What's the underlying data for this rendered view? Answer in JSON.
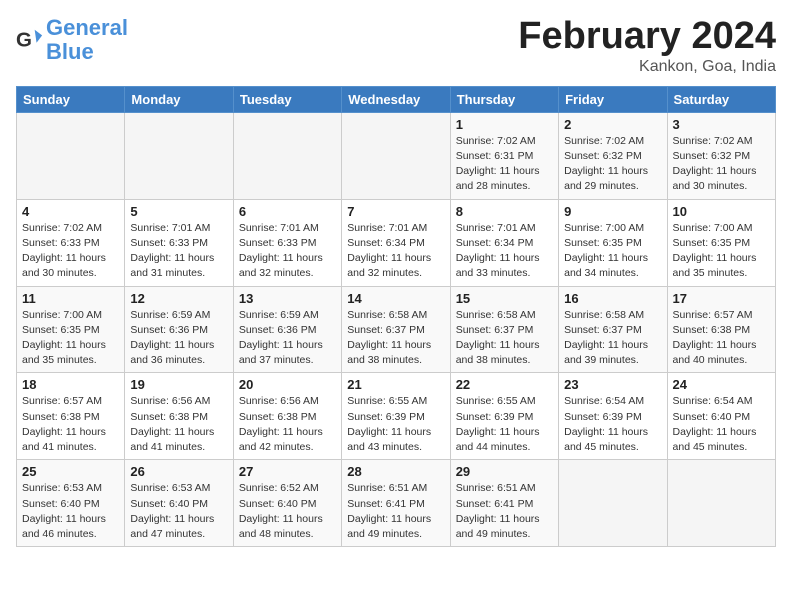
{
  "header": {
    "logo_line1": "General",
    "logo_line2": "Blue",
    "month_title": "February 2024",
    "subtitle": "Kankon, Goa, India"
  },
  "weekdays": [
    "Sunday",
    "Monday",
    "Tuesday",
    "Wednesday",
    "Thursday",
    "Friday",
    "Saturday"
  ],
  "weeks": [
    [
      {
        "day": "",
        "info": ""
      },
      {
        "day": "",
        "info": ""
      },
      {
        "day": "",
        "info": ""
      },
      {
        "day": "",
        "info": ""
      },
      {
        "day": "1",
        "info": "Sunrise: 7:02 AM\nSunset: 6:31 PM\nDaylight: 11 hours\nand 28 minutes."
      },
      {
        "day": "2",
        "info": "Sunrise: 7:02 AM\nSunset: 6:32 PM\nDaylight: 11 hours\nand 29 minutes."
      },
      {
        "day": "3",
        "info": "Sunrise: 7:02 AM\nSunset: 6:32 PM\nDaylight: 11 hours\nand 30 minutes."
      }
    ],
    [
      {
        "day": "4",
        "info": "Sunrise: 7:02 AM\nSunset: 6:33 PM\nDaylight: 11 hours\nand 30 minutes."
      },
      {
        "day": "5",
        "info": "Sunrise: 7:01 AM\nSunset: 6:33 PM\nDaylight: 11 hours\nand 31 minutes."
      },
      {
        "day": "6",
        "info": "Sunrise: 7:01 AM\nSunset: 6:33 PM\nDaylight: 11 hours\nand 32 minutes."
      },
      {
        "day": "7",
        "info": "Sunrise: 7:01 AM\nSunset: 6:34 PM\nDaylight: 11 hours\nand 32 minutes."
      },
      {
        "day": "8",
        "info": "Sunrise: 7:01 AM\nSunset: 6:34 PM\nDaylight: 11 hours\nand 33 minutes."
      },
      {
        "day": "9",
        "info": "Sunrise: 7:00 AM\nSunset: 6:35 PM\nDaylight: 11 hours\nand 34 minutes."
      },
      {
        "day": "10",
        "info": "Sunrise: 7:00 AM\nSunset: 6:35 PM\nDaylight: 11 hours\nand 35 minutes."
      }
    ],
    [
      {
        "day": "11",
        "info": "Sunrise: 7:00 AM\nSunset: 6:35 PM\nDaylight: 11 hours\nand 35 minutes."
      },
      {
        "day": "12",
        "info": "Sunrise: 6:59 AM\nSunset: 6:36 PM\nDaylight: 11 hours\nand 36 minutes."
      },
      {
        "day": "13",
        "info": "Sunrise: 6:59 AM\nSunset: 6:36 PM\nDaylight: 11 hours\nand 37 minutes."
      },
      {
        "day": "14",
        "info": "Sunrise: 6:58 AM\nSunset: 6:37 PM\nDaylight: 11 hours\nand 38 minutes."
      },
      {
        "day": "15",
        "info": "Sunrise: 6:58 AM\nSunset: 6:37 PM\nDaylight: 11 hours\nand 38 minutes."
      },
      {
        "day": "16",
        "info": "Sunrise: 6:58 AM\nSunset: 6:37 PM\nDaylight: 11 hours\nand 39 minutes."
      },
      {
        "day": "17",
        "info": "Sunrise: 6:57 AM\nSunset: 6:38 PM\nDaylight: 11 hours\nand 40 minutes."
      }
    ],
    [
      {
        "day": "18",
        "info": "Sunrise: 6:57 AM\nSunset: 6:38 PM\nDaylight: 11 hours\nand 41 minutes."
      },
      {
        "day": "19",
        "info": "Sunrise: 6:56 AM\nSunset: 6:38 PM\nDaylight: 11 hours\nand 41 minutes."
      },
      {
        "day": "20",
        "info": "Sunrise: 6:56 AM\nSunset: 6:38 PM\nDaylight: 11 hours\nand 42 minutes."
      },
      {
        "day": "21",
        "info": "Sunrise: 6:55 AM\nSunset: 6:39 PM\nDaylight: 11 hours\nand 43 minutes."
      },
      {
        "day": "22",
        "info": "Sunrise: 6:55 AM\nSunset: 6:39 PM\nDaylight: 11 hours\nand 44 minutes."
      },
      {
        "day": "23",
        "info": "Sunrise: 6:54 AM\nSunset: 6:39 PM\nDaylight: 11 hours\nand 45 minutes."
      },
      {
        "day": "24",
        "info": "Sunrise: 6:54 AM\nSunset: 6:40 PM\nDaylight: 11 hours\nand 45 minutes."
      }
    ],
    [
      {
        "day": "25",
        "info": "Sunrise: 6:53 AM\nSunset: 6:40 PM\nDaylight: 11 hours\nand 46 minutes."
      },
      {
        "day": "26",
        "info": "Sunrise: 6:53 AM\nSunset: 6:40 PM\nDaylight: 11 hours\nand 47 minutes."
      },
      {
        "day": "27",
        "info": "Sunrise: 6:52 AM\nSunset: 6:40 PM\nDaylight: 11 hours\nand 48 minutes."
      },
      {
        "day": "28",
        "info": "Sunrise: 6:51 AM\nSunset: 6:41 PM\nDaylight: 11 hours\nand 49 minutes."
      },
      {
        "day": "29",
        "info": "Sunrise: 6:51 AM\nSunset: 6:41 PM\nDaylight: 11 hours\nand 49 minutes."
      },
      {
        "day": "",
        "info": ""
      },
      {
        "day": "",
        "info": ""
      }
    ]
  ]
}
